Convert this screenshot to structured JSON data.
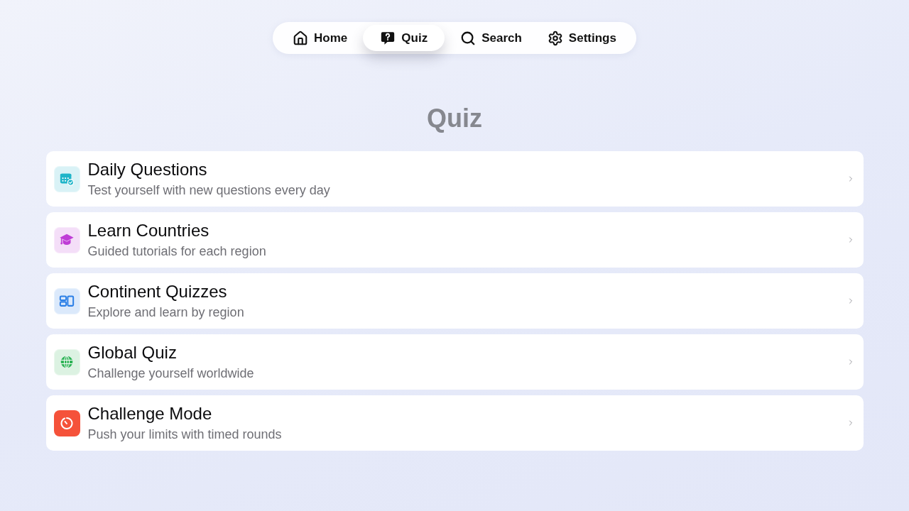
{
  "nav": {
    "tabs": [
      {
        "label": "Home",
        "selected": false
      },
      {
        "label": "Quiz",
        "selected": true
      },
      {
        "label": "Search",
        "selected": false
      },
      {
        "label": "Settings",
        "selected": false
      }
    ]
  },
  "page": {
    "title": "Quiz"
  },
  "menu": {
    "items": [
      {
        "title": "Daily Questions",
        "subtitle": "Test yourself with new questions every day",
        "kind": "tinted",
        "color": "#1fb5c9"
      },
      {
        "title": "Learn Countries",
        "subtitle": "Guided tutorials for each region",
        "kind": "tinted",
        "color": "#bf3dd6"
      },
      {
        "title": "Continent Quizzes",
        "subtitle": "Explore and learn by region",
        "kind": "tinted",
        "color": "#2b7fe6"
      },
      {
        "title": "Global Quiz",
        "subtitle": "Challenge yourself worldwide",
        "kind": "tinted",
        "color": "#2fb457"
      },
      {
        "title": "Challenge Mode",
        "subtitle": "Push your limits with timed rounds",
        "kind": "solid",
        "color": "#f5523a"
      }
    ]
  }
}
